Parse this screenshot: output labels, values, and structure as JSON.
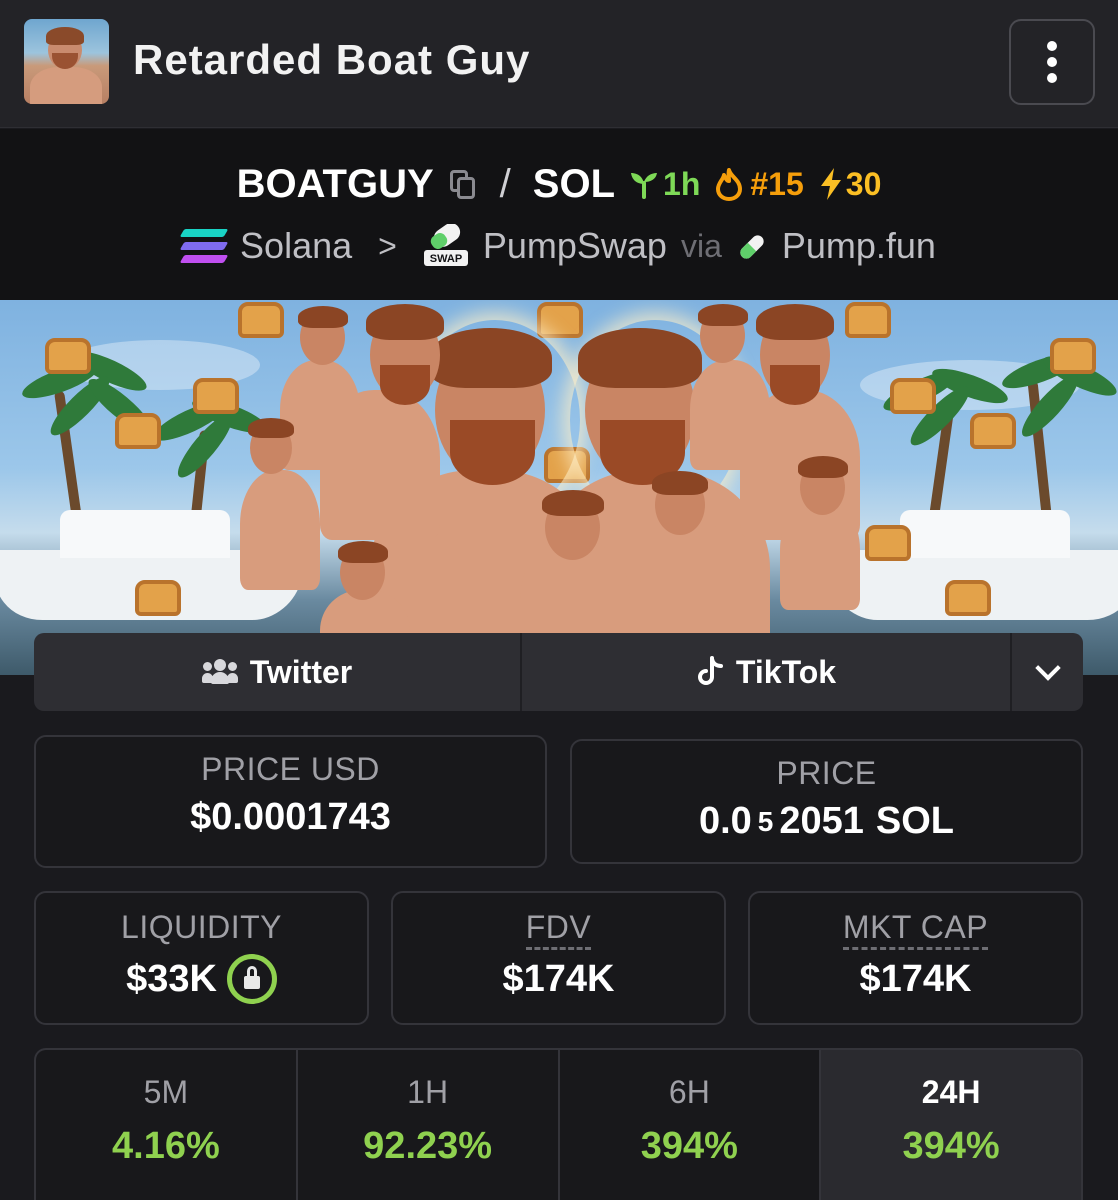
{
  "header": {
    "title": "Retarded Boat Guy",
    "menu_icon": "more-vertical-icon"
  },
  "pair": {
    "base": "BOATGUY",
    "separator": "/",
    "quote": "SOL",
    "age": "1h",
    "trending_rank": "#15",
    "boosts": "30",
    "chain": "Solana",
    "dex": "PumpSwap",
    "via_label": "via",
    "launchpad": "Pump.fun",
    "colors": {
      "age": "#7ed957",
      "trending": "#f59e0b",
      "boost": "#fbbf24"
    }
  },
  "social": {
    "twitter_label": "Twitter",
    "tiktok_label": "TikTok"
  },
  "stats": {
    "price_usd_label": "PRICE USD",
    "price_usd_value": "$0.0001743",
    "price_label": "PRICE",
    "price_prefix": "0.0",
    "price_subscript": "5",
    "price_digits": "2051",
    "price_unit": "SOL",
    "liquidity_label": "LIQUIDITY",
    "liquidity_value": "$33K",
    "fdv_label": "FDV",
    "fdv_value": "$174K",
    "mktcap_label": "MKT CAP",
    "mktcap_value": "$174K"
  },
  "timeframes": [
    {
      "label": "5M",
      "change": "4.16%"
    },
    {
      "label": "1H",
      "change": "92.23%"
    },
    {
      "label": "6H",
      "change": "394%"
    },
    {
      "label": "24H",
      "change": "394%"
    }
  ],
  "colors": {
    "positive": "#8fd14f",
    "background": "#1a1a1e"
  }
}
